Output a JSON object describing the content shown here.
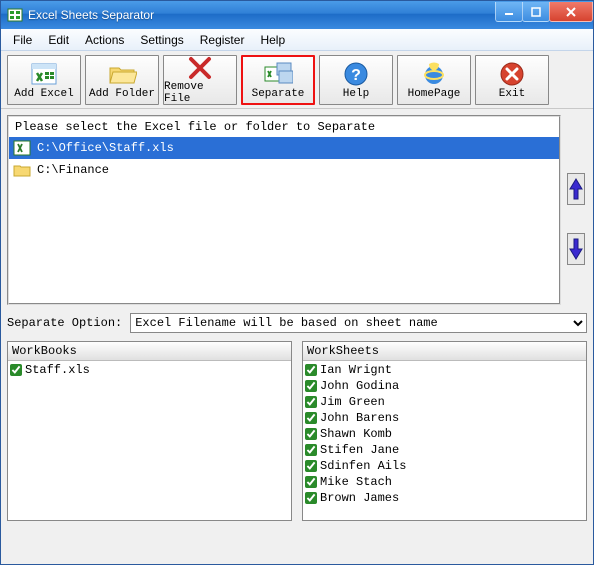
{
  "titlebar": {
    "title": "Excel Sheets Separator"
  },
  "menu": {
    "items": [
      "File",
      "Edit",
      "Actions",
      "Settings",
      "Register",
      "Help"
    ]
  },
  "toolbar": {
    "add_excel": "Add Excel",
    "add_folder": "Add Folder",
    "remove_file": "Remove File",
    "separate": "Separate",
    "help": "Help",
    "homepage": "HomePage",
    "exit": "Exit"
  },
  "filebox": {
    "header": "Please select the Excel file or folder to Separate",
    "items": [
      {
        "type": "file",
        "path": "C:\\Office\\Staff.xls",
        "selected": true
      },
      {
        "type": "folder",
        "path": "C:\\Finance",
        "selected": false
      }
    ]
  },
  "separate_option": {
    "label": "Separate Option:",
    "value": "Excel Filename will be based on sheet name"
  },
  "workbooks": {
    "header": "WorkBooks",
    "items": [
      {
        "name": "Staff.xls",
        "checked": true
      }
    ]
  },
  "worksheets": {
    "header": "WorkSheets",
    "items": [
      {
        "name": "Ian Wrignt",
        "checked": true
      },
      {
        "name": "John Godina",
        "checked": true
      },
      {
        "name": "Jim Green",
        "checked": true
      },
      {
        "name": "John Barens",
        "checked": true
      },
      {
        "name": "Shawn Komb",
        "checked": true
      },
      {
        "name": "Stifen Jane",
        "checked": true
      },
      {
        "name": "Sdinfen Ails",
        "checked": true
      },
      {
        "name": "Mike Stach",
        "checked": true
      },
      {
        "name": "Brown James",
        "checked": true
      }
    ]
  }
}
